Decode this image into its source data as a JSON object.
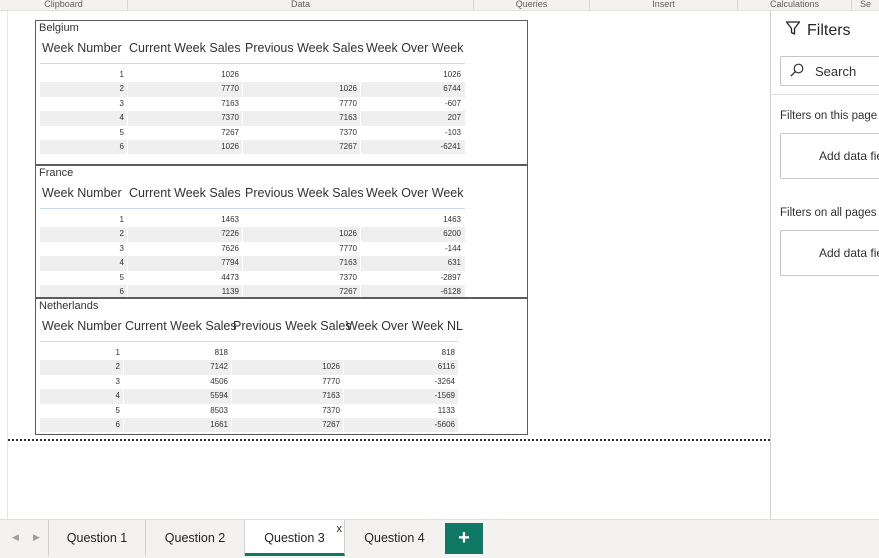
{
  "ribbon": {
    "groups": [
      {
        "label": "Clipboard"
      },
      {
        "label": "Data"
      },
      {
        "label": "Queries"
      },
      {
        "label": "Insert"
      },
      {
        "label": "Calculations"
      },
      {
        "label": "Se"
      }
    ]
  },
  "visual": {
    "sections": [
      {
        "title": "Belgium",
        "headers": [
          "Week Number",
          "Current Week Sales",
          "Previous Week Sales",
          "Week Over Week"
        ],
        "rows": [
          [
            "1",
            "1026",
            "",
            "1026"
          ],
          [
            "2",
            "7770",
            "1026",
            "6744"
          ],
          [
            "3",
            "7163",
            "7770",
            "-607"
          ],
          [
            "4",
            "7370",
            "7163",
            "207"
          ],
          [
            "5",
            "7267",
            "7370",
            "-103"
          ],
          [
            "6",
            "1026",
            "7267",
            "-6241"
          ]
        ]
      },
      {
        "title": "France",
        "headers": [
          "Week Number",
          "Current Week Sales",
          "Previous Week Sales",
          "Week Over Week"
        ],
        "rows": [
          [
            "1",
            "1463",
            "",
            "1463"
          ],
          [
            "2",
            "7226",
            "1026",
            "6200"
          ],
          [
            "3",
            "7626",
            "7770",
            "-144"
          ],
          [
            "4",
            "7794",
            "7163",
            "631"
          ],
          [
            "5",
            "4473",
            "7370",
            "-2897"
          ],
          [
            "6",
            "1139",
            "7267",
            "-6128"
          ]
        ]
      },
      {
        "title": "Netherlands",
        "headers": [
          "Week Number",
          "Current Week Sales",
          "Previous Week Sales",
          "Week Over Week NL"
        ],
        "rows": [
          [
            "1",
            "818",
            "",
            "818"
          ],
          [
            "2",
            "7142",
            "1026",
            "6116"
          ],
          [
            "3",
            "4506",
            "7770",
            "-3264"
          ],
          [
            "4",
            "5594",
            "7163",
            "-1569"
          ],
          [
            "5",
            "8503",
            "7370",
            "1133"
          ],
          [
            "6",
            "1661",
            "7267",
            "-5606"
          ]
        ]
      }
    ]
  },
  "filters": {
    "title": "Filters",
    "search_placeholder": "Search",
    "on_this_page_label": "Filters on this page",
    "on_this_page_add": "Add data fie",
    "on_all_pages_label": "Filters on all pages",
    "on_all_pages_add": "Add data fie"
  },
  "tabs": {
    "items": [
      {
        "label": "Question 1"
      },
      {
        "label": "Question 2"
      },
      {
        "label": "Question 3"
      },
      {
        "label": "Question 4"
      }
    ],
    "active_index": 2,
    "close_glyph": "x",
    "add_glyph": "+"
  },
  "colors": {
    "accent": "#117865",
    "header_line": "#c8dcee",
    "row_alt": "#f0eff0"
  }
}
